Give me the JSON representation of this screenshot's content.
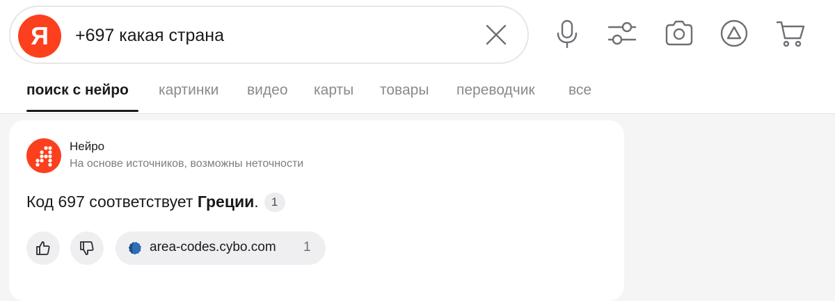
{
  "search": {
    "logo_letter": "Я",
    "query": "+697 какая страна"
  },
  "icons": {
    "clear": "close-icon",
    "voice": "microphone-icon",
    "filters": "filters-icon",
    "camera": "camera-icon",
    "alice": "alice-icon",
    "cart": "cart-icon"
  },
  "tabs": [
    {
      "label": "поиск с нейро",
      "active": true
    },
    {
      "label": "картинки"
    },
    {
      "label": "видео"
    },
    {
      "label": "карты"
    },
    {
      "label": "товары"
    },
    {
      "label": "переводчик"
    },
    {
      "label": "все"
    }
  ],
  "answer_card": {
    "title": "Нейро",
    "subtitle": "На основе источников, возможны неточности",
    "answer_prefix": "Код 697 соответствует ",
    "answer_bold": "Греции",
    "answer_suffix": ".",
    "citation": "1",
    "source": {
      "domain": "area-codes.cybo.com",
      "count": "1"
    }
  },
  "colors": {
    "brand": "#fc3f1d",
    "chip_bg": "#efeff2",
    "page_bg": "#f5f5f6"
  }
}
